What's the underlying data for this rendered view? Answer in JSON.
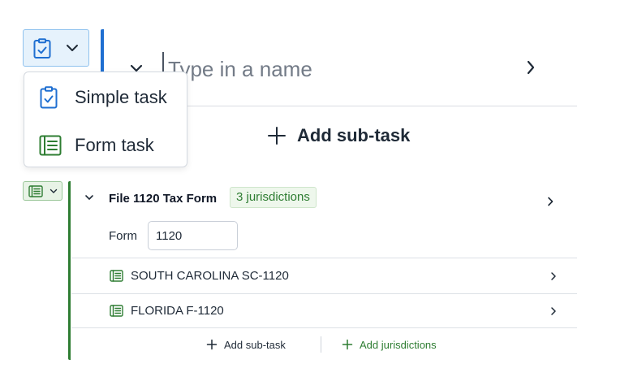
{
  "colors": {
    "accent_blue": "#1f6fd1",
    "accent_green": "#2e7d32",
    "type_button_bg": "#e6f2fc",
    "form_button_bg": "#e8f3e6",
    "badge_bg": "#eef7ec",
    "text_dark": "#1f2a37"
  },
  "new_task": {
    "type_button": {
      "icon": "clipboard-check-icon",
      "chevron_icon": "chevron-down-icon"
    },
    "collapse_icon": "chevron-down-icon",
    "name_input": {
      "placeholder": "Type in a name",
      "value": ""
    },
    "expand_icon": "chevron-right-icon",
    "add_subtask_label": "Add sub-task",
    "add_icon": "plus-icon"
  },
  "type_menu": {
    "items": [
      {
        "label": "Simple task",
        "icon": "clipboard-check-icon"
      },
      {
        "label": "Form task",
        "icon": "form-list-icon"
      }
    ]
  },
  "form_task": {
    "type_button": {
      "icon": "form-list-icon",
      "chevron_icon": "chevron-down-icon"
    },
    "title": "File 1120 Tax Form",
    "badge": "3 jurisdictions",
    "form_label": "Form",
    "form_value": "1120",
    "jurisdictions": [
      {
        "label": "SOUTH CAROLINA SC-1120",
        "icon": "form-list-icon"
      },
      {
        "label": "FLORIDA F-1120",
        "icon": "form-list-icon"
      }
    ],
    "footer": {
      "add_subtask_label": "Add sub-task",
      "add_jurisdictions_label": "Add jurisdictions"
    }
  }
}
